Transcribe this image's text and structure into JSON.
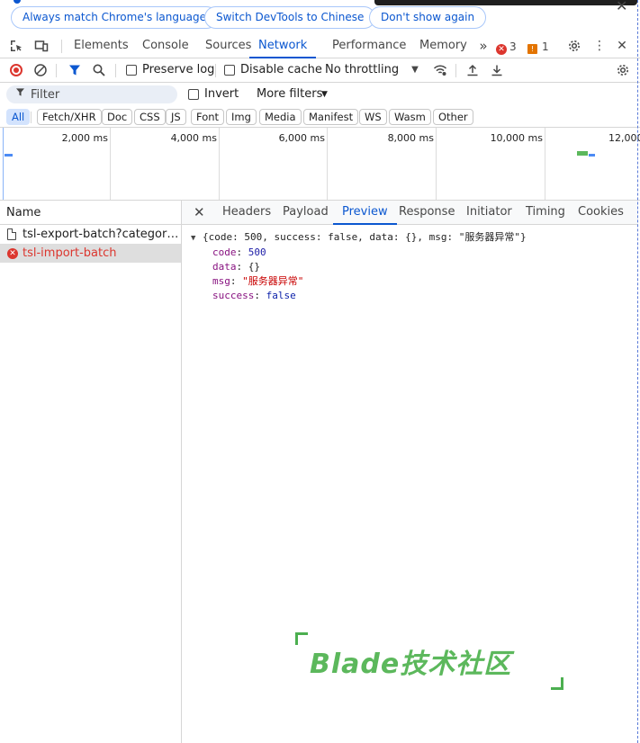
{
  "banner": {
    "match_language": "Always match Chrome's language",
    "switch_language": "Switch DevTools to Chinese",
    "dont_show": "Don't show again"
  },
  "tabs": [
    "Elements",
    "Console",
    "Sources",
    "Network",
    "Performance",
    "Memory"
  ],
  "active_tab": "Network",
  "issues": {
    "errors": "3",
    "warnings": "1"
  },
  "toolbar": {
    "preserve_log": "Preserve log",
    "disable_cache": "Disable cache",
    "throttling": "No throttling"
  },
  "filter": {
    "placeholder": "Filter",
    "invert": "Invert",
    "more_filters": "More filters"
  },
  "type_filters": [
    "All",
    "Fetch/XHR",
    "Doc",
    "CSS",
    "JS",
    "Font",
    "Img",
    "Media",
    "Manifest",
    "WS",
    "Wasm",
    "Other"
  ],
  "timeline": {
    "ticks": [
      "2,000 ms",
      "4,000 ms",
      "6,000 ms",
      "8,000 ms",
      "10,000 ms",
      "12,000"
    ]
  },
  "requests": {
    "header": "Name",
    "rows": [
      {
        "name": "tsl-export-batch?categoryId...",
        "status": "ok"
      },
      {
        "name": "tsl-import-batch",
        "status": "error"
      }
    ]
  },
  "detail_tabs": [
    "Headers",
    "Payload",
    "Preview",
    "Response",
    "Initiator",
    "Timing",
    "Cookies"
  ],
  "active_detail_tab": "Preview",
  "preview": {
    "summary": "{code: 500, success: false, data: {}, msg: \"服务器异常\"}",
    "code_key": "code",
    "code_val": "500",
    "data_key": "data",
    "data_val": "{}",
    "msg_key": "msg",
    "msg_val": "\"服务器异常\"",
    "success_key": "success",
    "success_val": "false"
  },
  "watermark": "Blade技术社区",
  "colors": {
    "accent": "#0b57d0",
    "error": "#dc362e",
    "watermark": "#5cb85c"
  }
}
